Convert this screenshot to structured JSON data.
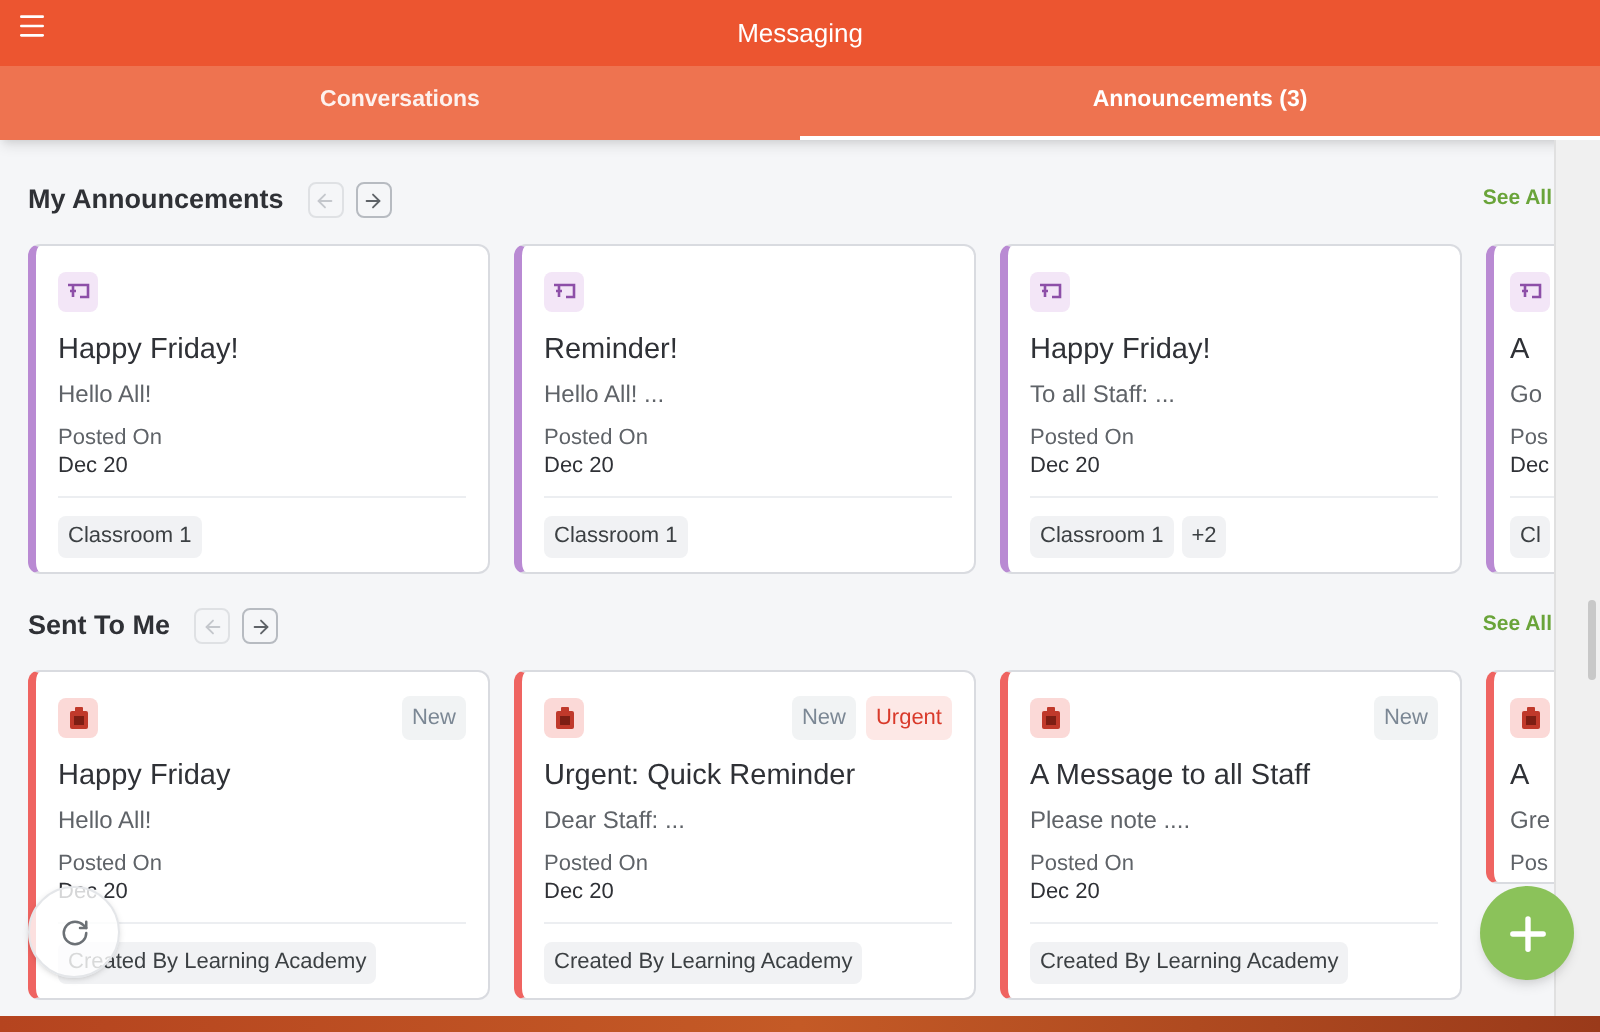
{
  "app_bar": {
    "title": "Messaging"
  },
  "tabs": [
    {
      "label": "Conversations",
      "selected": false
    },
    {
      "label": "Announcements (3)",
      "selected": true
    }
  ],
  "sections": [
    {
      "title": "My Announcements",
      "kind": "mine",
      "nav": [
        {
          "kind": "back",
          "disabled": true
        },
        {
          "kind": "forward",
          "disabled": false
        }
      ],
      "see_all": "See All",
      "cards": [
        {
          "title": "Happy Friday!",
          "body": "Hello All!",
          "posted_label": "Posted On",
          "date": "Dec 20",
          "tags": [
            "Classroom 1"
          ],
          "clipped": false
        },
        {
          "title": "Reminder!",
          "body": "Hello All! ...",
          "posted_label": "Posted On",
          "date": "Dec 20",
          "tags": [
            "Classroom 1"
          ],
          "clipped": false
        },
        {
          "title": "Happy Friday!",
          "body": "To all Staff: ...",
          "posted_label": "Posted On",
          "date": "Dec 20",
          "tags": [
            "Classroom 1",
            "+2"
          ],
          "clipped": false
        },
        {
          "title": "A",
          "body": "Go",
          "posted_label": "Pos",
          "date": "Dec",
          "tags": [
            "Cl"
          ],
          "clipped": true
        }
      ]
    },
    {
      "title": "Sent To Me",
      "kind": "received",
      "nav": [
        {
          "kind": "back",
          "disabled": true
        },
        {
          "kind": "forward",
          "disabled": false
        }
      ],
      "see_all": "See All",
      "cards": [
        {
          "title": "Happy Friday",
          "body": "Hello All!",
          "posted_label": "Posted On",
          "date": "Dec 20",
          "tags": [
            "Created By Learning Academy"
          ],
          "badges": [
            {
              "text": "New",
              "kind": "new"
            }
          ],
          "clipped": false
        },
        {
          "title": "Urgent: Quick Reminder",
          "body": "Dear Staff: ...",
          "posted_label": "Posted On",
          "date": "Dec 20",
          "tags": [
            "Created By Learning Academy"
          ],
          "badges": [
            {
              "text": "New",
              "kind": "new"
            },
            {
              "text": "Urgent",
              "kind": "urgent"
            }
          ],
          "clipped": false
        },
        {
          "title": "A Message to all Staff",
          "body": "Please note ....",
          "posted_label": "Posted On",
          "date": "Dec 20",
          "tags": [
            "Created By Learning Academy"
          ],
          "badges": [
            {
              "text": "New",
              "kind": "new"
            }
          ],
          "clipped": false
        },
        {
          "title": "A",
          "body": "Gre",
          "posted_label": "Pos",
          "clipped": true
        }
      ]
    }
  ]
}
